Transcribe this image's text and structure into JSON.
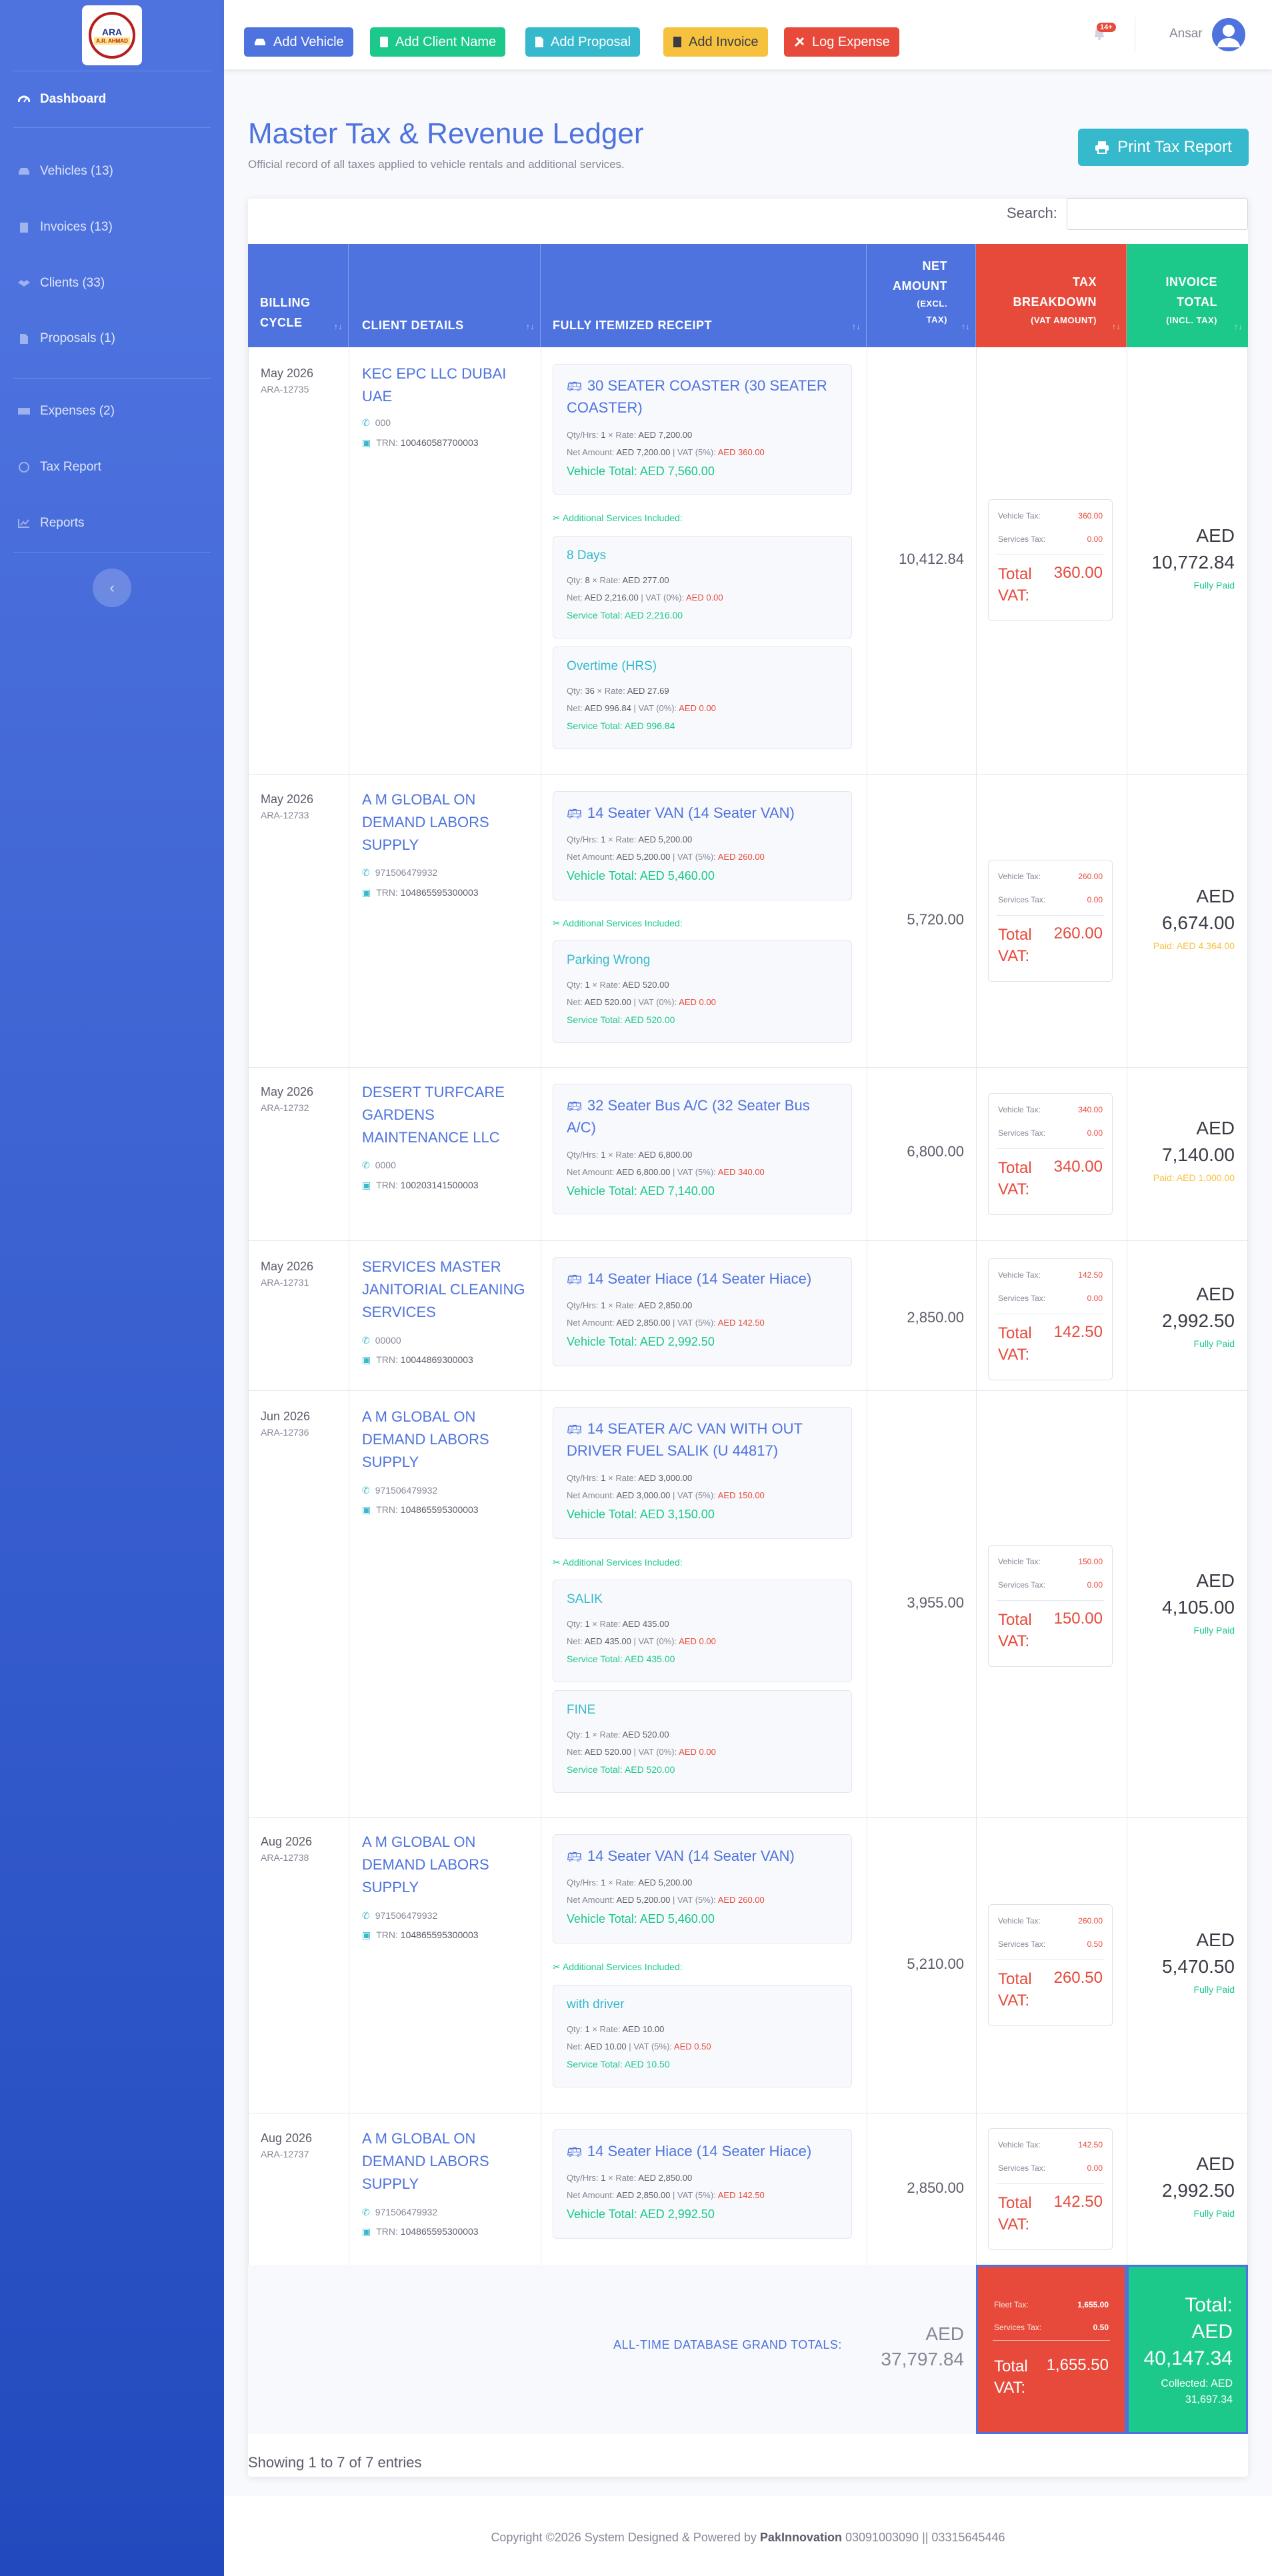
{
  "logo": {
    "line1": "ARA",
    "line2": "A.R. AHMAD",
    "line3": "PASSENGER TRANSPORT"
  },
  "sidebar": {
    "items": [
      {
        "icon": "dashboard-icon",
        "label": "Dashboard",
        "active": true
      },
      {
        "icon": "car-icon",
        "label": "Vehicles (13)"
      },
      {
        "icon": "invoice-icon",
        "label": "Invoices (13)"
      },
      {
        "icon": "handshake-icon",
        "label": "Clients (33)"
      },
      {
        "icon": "file-icon",
        "label": "Proposals (1)"
      },
      {
        "icon": "money-icon",
        "label": "Expenses (2)"
      },
      {
        "icon": "percent-icon",
        "label": "Tax Report"
      },
      {
        "icon": "chart-icon",
        "label": "Reports"
      }
    ],
    "toggle": "‹"
  },
  "toolbar": {
    "buttons": [
      {
        "label": "Add Vehicle",
        "color": "#4e73df"
      },
      {
        "label": "Add Client Name",
        "color": "#1cc88a"
      },
      {
        "label": "Add Proposal",
        "color": "#36b9cc"
      },
      {
        "label": "Add Invoice",
        "color": "#f6c23e"
      },
      {
        "label": "Log Expense",
        "color": "#e74a3b"
      }
    ],
    "alerts_badge": "14+",
    "user_name": "Ansar"
  },
  "page": {
    "title": "Master Tax & Revenue Ledger",
    "subtitle": "Official record of all taxes applied to vehicle rentals and additional services.",
    "print_button": "Print Tax Report",
    "search_label": "Search:",
    "search_value": ""
  },
  "table": {
    "headers": {
      "billing_cycle": "BILLING CYCLE",
      "client_details": "CLIENT DETAILS",
      "receipt": "FULLY ITEMIZED RECEIPT",
      "net_l1": "NET",
      "net_l2": "AMOUNT",
      "net_l3": "(EXCL.",
      "net_l4": "TAX)",
      "tax_l1": "TAX",
      "tax_l2": "BREAKDOWN",
      "tax_l3": "(VAT AMOUNT)",
      "inv_l1": "INVOICE",
      "inv_l2": "TOTAL",
      "inv_l3": "(INCL. TAX)"
    },
    "additional_label": "Additional Services Included:",
    "labels": {
      "vehicle_tax": "Vehicle Tax:",
      "services_tax": "Services Tax:",
      "total_vat_1": "Total",
      "total_vat_2": "VAT:"
    },
    "rows": [
      {
        "cycle": "May 2026",
        "id": "ARA-12735",
        "client": "KEC EPC LLC DUBAI UAE",
        "phone": "000",
        "trn_label": "TRN:",
        "trn": "100460587700003",
        "vehicle": {
          "name": "30 SEATER COASTER (30 SEATER COASTER)",
          "qty": "Qty/Hrs: ",
          "qty_v": "1",
          "x": " × Rate: ",
          "rate_v": "AED 7,200.00",
          "net_l": "Net Amount: ",
          "net_v": "AED 7,200.00",
          "vat_l": " | VAT (5%): ",
          "vat_v": "AED 360.00",
          "total": "Vehicle Total: AED 7,560.00"
        },
        "services": [
          {
            "name": "8 Days",
            "q": "Qty: ",
            "qv": "8",
            "x": " × Rate: ",
            "rv": "AED 277.00",
            "nl": "Net: ",
            "nv": "AED 2,216.00",
            "vl": " | VAT (0%): ",
            "vv": "AED 0.00",
            "total": "Service Total: AED 2,216.00"
          },
          {
            "name": "Overtime (HRS)",
            "q": "Qty: ",
            "qv": "36",
            "x": " × Rate: ",
            "rv": "AED 27.69",
            "nl": "Net: ",
            "nv": "AED 996.84",
            "vl": " | VAT (0%): ",
            "vv": "AED 0.00",
            "total": "Service Total: AED 996.84"
          }
        ],
        "net": "10,412.84",
        "vtax": "360.00",
        "stax": "0.00",
        "tvat": "360.00",
        "inv_cur": "AED",
        "inv_amt": "10,772.84",
        "status": "Fully Paid",
        "paid": true
      },
      {
        "cycle": "May 2026",
        "id": "ARA-12733",
        "client": "A M GLOBAL ON DEMAND LABORS SUPPLY",
        "phone": "971506479932",
        "trn_label": "TRN:",
        "trn": "104865595300003",
        "vehicle": {
          "name": "14 Seater VAN (14 Seater VAN)",
          "qty": "Qty/Hrs: ",
          "qty_v": "1",
          "x": " × Rate: ",
          "rate_v": "AED 5,200.00",
          "net_l": "Net Amount: ",
          "net_v": "AED 5,200.00",
          "vat_l": " | VAT (5%): ",
          "vat_v": "AED 260.00",
          "total": "Vehicle Total: AED 5,460.00"
        },
        "services": [
          {
            "name": "Parking Wrong",
            "q": "Qty: ",
            "qv": "1",
            "x": " × Rate: ",
            "rv": "AED 520.00",
            "nl": "Net: ",
            "nv": "AED 520.00",
            "vl": " | VAT (0%): ",
            "vv": "AED 0.00",
            "total": "Service Total: AED 520.00"
          }
        ],
        "net": "5,720.00",
        "vtax": "260.00",
        "stax": "0.00",
        "tvat": "260.00",
        "inv_cur": "AED",
        "inv_amt": "6,674.00",
        "status": "Paid: AED 4,364.00",
        "paid": false
      },
      {
        "cycle": "May 2026",
        "id": "ARA-12732",
        "client": "DESERT TURFCARE GARDENS MAINTENANCE LLC",
        "phone": "0000",
        "trn_label": "TRN:",
        "trn": "100203141500003",
        "vehicle": {
          "name": "32 Seater Bus A/C (32 Seater Bus A/C)",
          "qty": "Qty/Hrs: ",
          "qty_v": "1",
          "x": " × Rate: ",
          "rate_v": "AED 6,800.00",
          "net_l": "Net Amount: ",
          "net_v": "AED 6,800.00",
          "vat_l": " | VAT (5%): ",
          "vat_v": "AED 340.00",
          "total": "Vehicle Total: AED 7,140.00"
        },
        "services": [],
        "net": "6,800.00",
        "vtax": "340.00",
        "stax": "0.00",
        "tvat": "340.00",
        "inv_cur": "AED",
        "inv_amt": "7,140.00",
        "status": "Paid: AED 1,000.00",
        "paid": false
      },
      {
        "cycle": "May 2026",
        "id": "ARA-12731",
        "client": "SERVICES MASTER JANITORIAL CLEANING SERVICES",
        "phone": "00000",
        "trn_label": "TRN:",
        "trn": "10044869300003",
        "vehicle": {
          "name": "14 Seater Hiace (14 Seater Hiace)",
          "qty": "Qty/Hrs: ",
          "qty_v": "1",
          "x": " × Rate: ",
          "rate_v": "AED 2,850.00",
          "net_l": "Net Amount: ",
          "net_v": "AED 2,850.00",
          "vat_l": " | VAT (5%): ",
          "vat_v": "AED 142.50",
          "total": "Vehicle Total: AED 2,992.50"
        },
        "services": [],
        "net": "2,850.00",
        "vtax": "142.50",
        "stax": "0.00",
        "tvat": "142.50",
        "inv_cur": "AED",
        "inv_amt": "2,992.50",
        "status": "Fully Paid",
        "paid": true
      },
      {
        "cycle": "Jun 2026",
        "id": "ARA-12736",
        "client": "A M GLOBAL ON DEMAND LABORS SUPPLY",
        "phone": "971506479932",
        "trn_label": "TRN:",
        "trn": "104865595300003",
        "vehicle": {
          "name": "14 SEATER A/C VAN WITH OUT DRIVER FUEL SALIK (U 44817)",
          "qty": "Qty/Hrs: ",
          "qty_v": "1",
          "x": " × Rate: ",
          "rate_v": "AED 3,000.00",
          "net_l": "Net Amount: ",
          "net_v": "AED 3,000.00",
          "vat_l": " | VAT (5%): ",
          "vat_v": "AED 150.00",
          "total": "Vehicle Total: AED 3,150.00"
        },
        "services": [
          {
            "name": "SALIK",
            "q": "Qty: ",
            "qv": "1",
            "x": " × Rate: ",
            "rv": "AED 435.00",
            "nl": "Net: ",
            "nv": "AED 435.00",
            "vl": " | VAT (0%): ",
            "vv": "AED 0.00",
            "total": "Service Total: AED 435.00"
          },
          {
            "name": "FINE",
            "q": "Qty: ",
            "qv": "1",
            "x": " × Rate: ",
            "rv": "AED 520.00",
            "nl": "Net: ",
            "nv": "AED 520.00",
            "vl": " | VAT (0%): ",
            "vv": "AED 0.00",
            "total": "Service Total: AED 520.00"
          }
        ],
        "net": "3,955.00",
        "vtax": "150.00",
        "stax": "0.00",
        "tvat": "150.00",
        "inv_cur": "AED",
        "inv_amt": "4,105.00",
        "status": "Fully Paid",
        "paid": true
      },
      {
        "cycle": "Aug 2026",
        "id": "ARA-12738",
        "client": "A M GLOBAL ON DEMAND LABORS SUPPLY",
        "phone": "971506479932",
        "trn_label": "TRN:",
        "trn": "104865595300003",
        "vehicle": {
          "name": "14 Seater VAN (14 Seater VAN)",
          "qty": "Qty/Hrs: ",
          "qty_v": "1",
          "x": " × Rate: ",
          "rate_v": "AED 5,200.00",
          "net_l": "Net Amount: ",
          "net_v": "AED 5,200.00",
          "vat_l": " | VAT (5%): ",
          "vat_v": "AED 260.00",
          "total": "Vehicle Total: AED 5,460.00"
        },
        "services": [
          {
            "name": "with driver",
            "q": "Qty: ",
            "qv": "1",
            "x": " × Rate: ",
            "rv": "AED 10.00",
            "nl": "Net: ",
            "nv": "AED 10.00",
            "vl": " | VAT (5%): ",
            "vv": "AED 0.50",
            "total": "Service Total: AED 10.50"
          }
        ],
        "net": "5,210.00",
        "vtax": "260.00",
        "stax": "0.50",
        "tvat": "260.50",
        "inv_cur": "AED",
        "inv_amt": "5,470.50",
        "status": "Fully Paid",
        "paid": true
      },
      {
        "cycle": "Aug 2026",
        "id": "ARA-12737",
        "client": "A M GLOBAL ON DEMAND LABORS SUPPLY",
        "phone": "971506479932",
        "trn_label": "TRN:",
        "trn": "104865595300003",
        "vehicle": {
          "name": "14 Seater Hiace (14 Seater Hiace)",
          "qty": "Qty/Hrs: ",
          "qty_v": "1",
          "x": " × Rate: ",
          "rate_v": "AED 2,850.00",
          "net_l": "Net Amount: ",
          "net_v": "AED 2,850.00",
          "vat_l": " | VAT (5%): ",
          "vat_v": "AED 142.50",
          "total": "Vehicle Total: AED 2,992.50"
        },
        "services": [],
        "net": "2,850.00",
        "vtax": "142.50",
        "stax": "0.00",
        "tvat": "142.50",
        "inv_cur": "AED",
        "inv_amt": "2,992.50",
        "status": "Fully Paid",
        "paid": true
      }
    ],
    "grand": {
      "label": "ALL-TIME DATABASE GRAND TOTALS:",
      "net_cur": "AED",
      "net": "37,797.84",
      "fleet_l": "Fleet Tax:",
      "fleet_v": "1,655.00",
      "svc_l": "Services Tax:",
      "svc_v": "0.50",
      "tv_1": "Total",
      "tv_2": "VAT:",
      "tvat": "1,655.50",
      "tot_l": "Total:",
      "tot_cur": "AED",
      "tot": "40,147.34",
      "coll_l": "Collected: AED",
      "coll": "31,697.34"
    }
  },
  "pagination": {
    "info": "Showing 1 to 7 of 7 entries"
  },
  "footer": {
    "pre": "Copyright ©2026 System Designed & Powered by ",
    "brand": "PakInnovation",
    "post": " 03091003090 || 03315645446"
  }
}
